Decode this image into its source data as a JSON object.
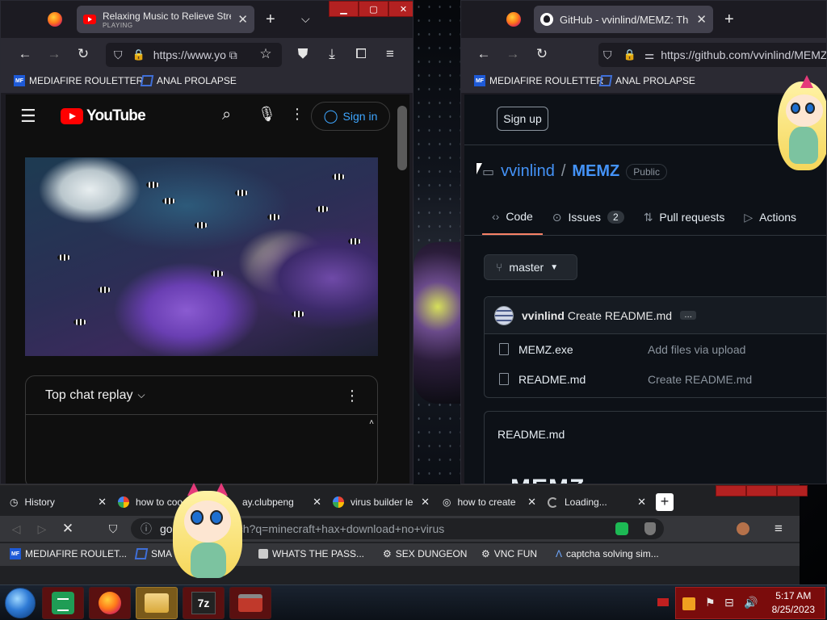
{
  "left_window": {
    "tab_title": "Relaxing Music to Relieve Stress",
    "tab_status": "PLAYING",
    "url": "https://www.yo",
    "bookmarks": [
      "MEDIAFIRE ROULETTER",
      "ANAL PROLAPSE"
    ],
    "youtube": {
      "logo_text": "YouTube",
      "signin_label": "Sign in",
      "chat_title": "Top chat replay"
    }
  },
  "right_window": {
    "tab_title": "GitHub - vvinlind/MEMZ: The",
    "url": "https://github.com/vvinlind/MEMZ",
    "bookmarks": [
      "MEDIAFIRE ROULETTER",
      "ANAL PROLAPSE"
    ],
    "github": {
      "signup_label": "Sign up",
      "owner": "vvinlind",
      "repo": "MEMZ",
      "visibility": "Public",
      "tabs": [
        {
          "label": "Code",
          "icon": "code-icon"
        },
        {
          "label": "Issues",
          "icon": "issue-icon",
          "count": "2"
        },
        {
          "label": "Pull requests",
          "icon": "pull-request-icon"
        },
        {
          "label": "Actions",
          "icon": "play-icon"
        }
      ],
      "branch": "master",
      "last_commit": {
        "author": "vvinlind",
        "message": "Create README.md"
      },
      "files": [
        {
          "name": "MEMZ.exe",
          "message": "Add files via upload"
        },
        {
          "name": "README.md",
          "message": "Create README.md"
        }
      ],
      "readme_title": "README.md",
      "readme_heading": "MEMZ"
    }
  },
  "bottom_window": {
    "tabs": [
      {
        "label": "History",
        "icon": "history-icon"
      },
      {
        "label": "how to coo",
        "icon": "google-icon"
      },
      {
        "label": "ay.clubpeng",
        "icon": "page-icon"
      },
      {
        "label": "virus builder le",
        "icon": "google-icon"
      },
      {
        "label": "how to create",
        "icon": "page-icon"
      },
      {
        "label": "Loading...",
        "icon": "loading-icon"
      }
    ],
    "url_domain": "goo",
    "url_rest": "arch?q=minecraft+hax+download+no+virus",
    "bookmarks": [
      "MEDIAFIRE ROULET...",
      "SMA",
      "WHATS THE PASS...",
      "SEX DUNGEON",
      "VNC FUN",
      "captcha solving sim..."
    ]
  },
  "taskbar": {
    "time": "5:17 AM",
    "date": "8/25/2023",
    "apps": [
      "sheets-icon",
      "firefox-icon",
      "file-explorer-icon",
      "7zip-icon",
      "toolbox-icon"
    ]
  }
}
